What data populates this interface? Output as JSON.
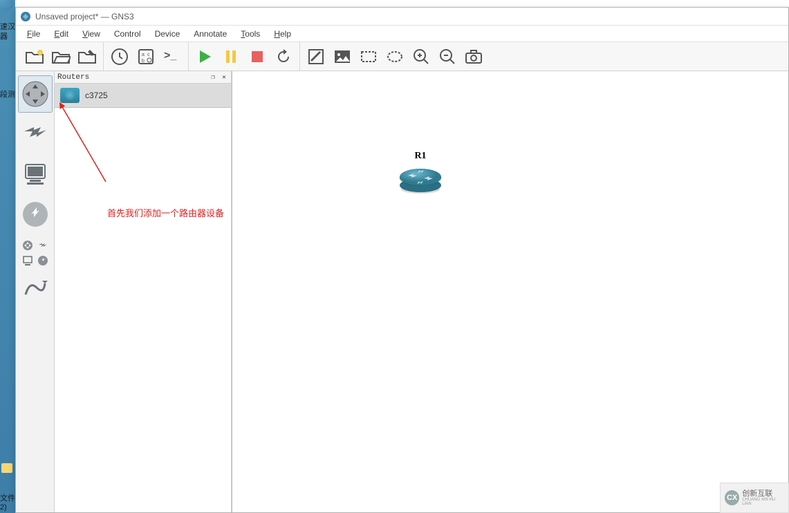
{
  "titlebar": {
    "title": "Unsaved project* — GNS3"
  },
  "menu": {
    "items": [
      "File",
      "Edit",
      "View",
      "Control",
      "Device",
      "Annotate",
      "Tools",
      "Help"
    ]
  },
  "desktop": {
    "text_top_a": "速汉",
    "text_top_b": "器",
    "text_mid": "段测",
    "text_bot_a": "文件",
    "text_bot_b": "2)"
  },
  "routers_panel": {
    "title": "Routers",
    "items": [
      {
        "name": "c3725"
      }
    ]
  },
  "canvas": {
    "nodes": [
      {
        "id": "r1",
        "label": "R1"
      }
    ]
  },
  "annotation": {
    "text": "首先我们添加一个路由器设备"
  },
  "watermark": {
    "logo": "CX",
    "text": "创新互联",
    "sub": "CHUANG XIN HU LIAN"
  }
}
